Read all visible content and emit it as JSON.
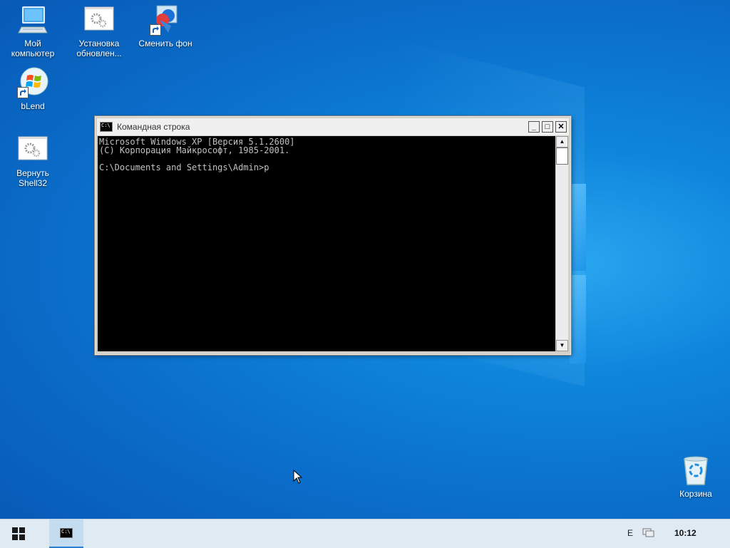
{
  "desktop": {
    "icons": [
      {
        "label": "Мой\nкомпьютер",
        "icon": "computer-icon"
      },
      {
        "label": "Установка\nобновлен...",
        "icon": "gear-icon"
      },
      {
        "label": "Сменить фон",
        "icon": "paint-icon"
      },
      {
        "label": "bLend",
        "icon": "windows7-orb-icon"
      },
      {
        "label": "Вернуть\nShell32",
        "icon": "gear-icon"
      },
      {
        "label": "Корзина",
        "icon": "recycle-bin-icon"
      }
    ]
  },
  "console": {
    "title": "Командная строка",
    "title_icon_text": "C:\\",
    "buttons": {
      "minimize": "_",
      "maximize": "□",
      "close": "✕"
    },
    "lines": [
      "Microsoft Windows XP [Версия 5.1.2600]",
      "(С) Корпорация Майкрософт, 1985-2001.",
      "",
      "C:\\Documents and Settings\\Admin>p"
    ]
  },
  "taskbar": {
    "start_icon": "windows-logo-icon",
    "active_task_icon_text": "C:\\",
    "language": "E",
    "network_icon": "network-icon",
    "clock": "10:12"
  },
  "colors": {
    "desktop_blue": "#0a6fcb",
    "console_bg": "#000000",
    "console_fg": "#c0c0c0",
    "taskbar_bg": "#dfeaf2"
  }
}
